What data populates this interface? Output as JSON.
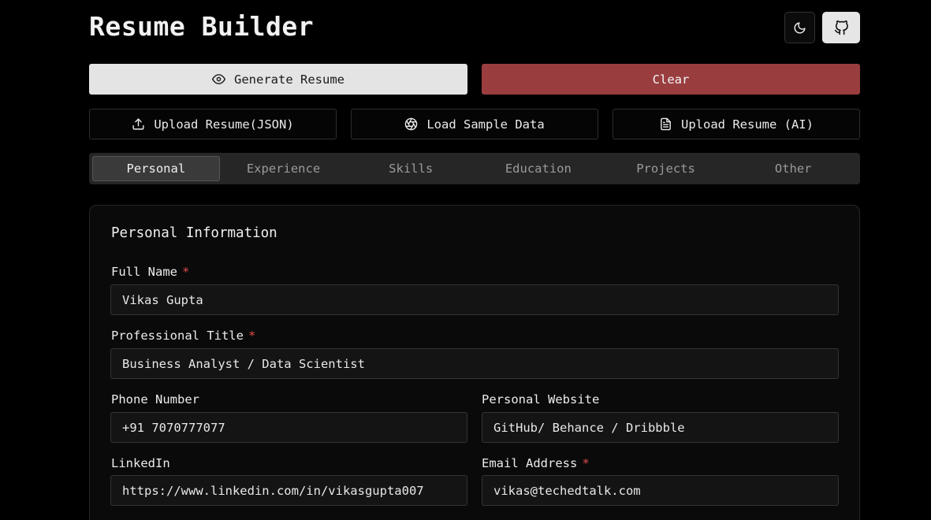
{
  "header": {
    "title": "Resume Builder"
  },
  "actions": {
    "generate_label": "Generate Resume",
    "clear_label": "Clear",
    "upload_json_label": "Upload Resume(JSON)",
    "sample_label": "Load Sample Data",
    "upload_ai_label": "Upload Resume (AI)"
  },
  "tabs": [
    {
      "label": "Personal",
      "active": true
    },
    {
      "label": "Experience"
    },
    {
      "label": "Skills"
    },
    {
      "label": "Education"
    },
    {
      "label": "Projects"
    },
    {
      "label": "Other"
    }
  ],
  "form": {
    "title": "Personal Information",
    "required_mark": "*",
    "full_name": {
      "label": "Full Name",
      "value": "Vikas Gupta"
    },
    "professional_title": {
      "label": "Professional Title",
      "value": "Business Analyst / Data Scientist"
    },
    "phone": {
      "label": "Phone Number",
      "value": "+91 7070777077"
    },
    "website": {
      "label": "Personal Website",
      "placeholder": "GitHub/ Behance / Dribbble"
    },
    "linkedin": {
      "label": "LinkedIn",
      "value": "https://www.linkedin.com/in/vikasgupta007"
    },
    "email": {
      "label": "Email Address",
      "value": "vikas@techedtalk.com"
    }
  },
  "icons": [
    "moon-icon",
    "github-icon",
    "eye-icon",
    "upload-icon",
    "aperture-icon",
    "file-text-icon"
  ],
  "colors": {
    "clear": "#993d3f",
    "required": "#e04a4a",
    "generate": "#e4e4e4"
  }
}
